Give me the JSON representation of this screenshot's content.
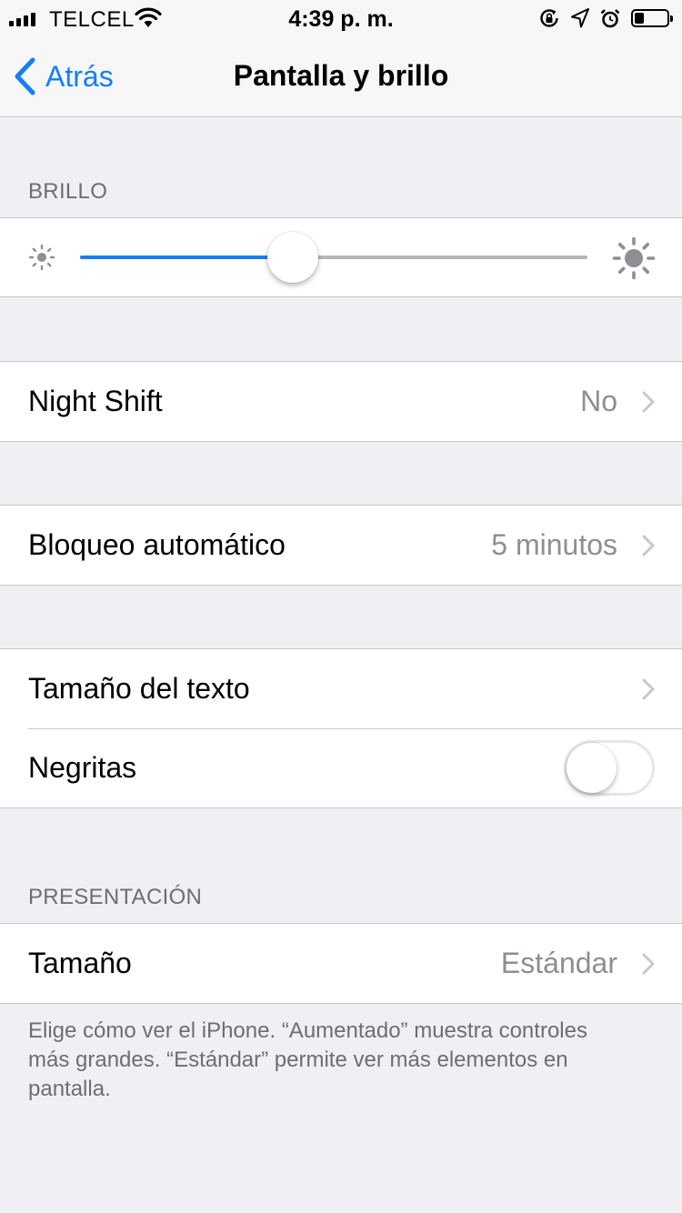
{
  "status_bar": {
    "carrier": "TELCEL",
    "time": "4:39 p. m.",
    "icons": [
      "signal-icon",
      "wifi-icon",
      "rotation-lock-icon",
      "location-icon",
      "alarm-icon",
      "battery-icon"
    ],
    "battery_level": 0.3
  },
  "nav": {
    "back_label": "Atrás",
    "title": "Pantalla y brillo"
  },
  "brightness": {
    "header": "BRILLO",
    "level": 0.42
  },
  "night_shift": {
    "label": "Night Shift",
    "value": "No"
  },
  "auto_lock": {
    "label": "Bloqueo automático",
    "value": "5 minutos"
  },
  "text_size": {
    "label": "Tamaño del texto"
  },
  "bold_text": {
    "label": "Negritas",
    "enabled": false
  },
  "display_zoom": {
    "header": "PRESENTACIÓN",
    "label": "Tamaño",
    "value": "Estándar",
    "footer": "Elige cómo ver el iPhone. “Aumentado” muestra controles más grandes. “Estándar” permite ver más elementos en pantalla."
  },
  "colors": {
    "accent": "#147efb",
    "background": "#efeff4",
    "secondary_text": "#8e8e93",
    "header_text": "#6d6d72"
  }
}
